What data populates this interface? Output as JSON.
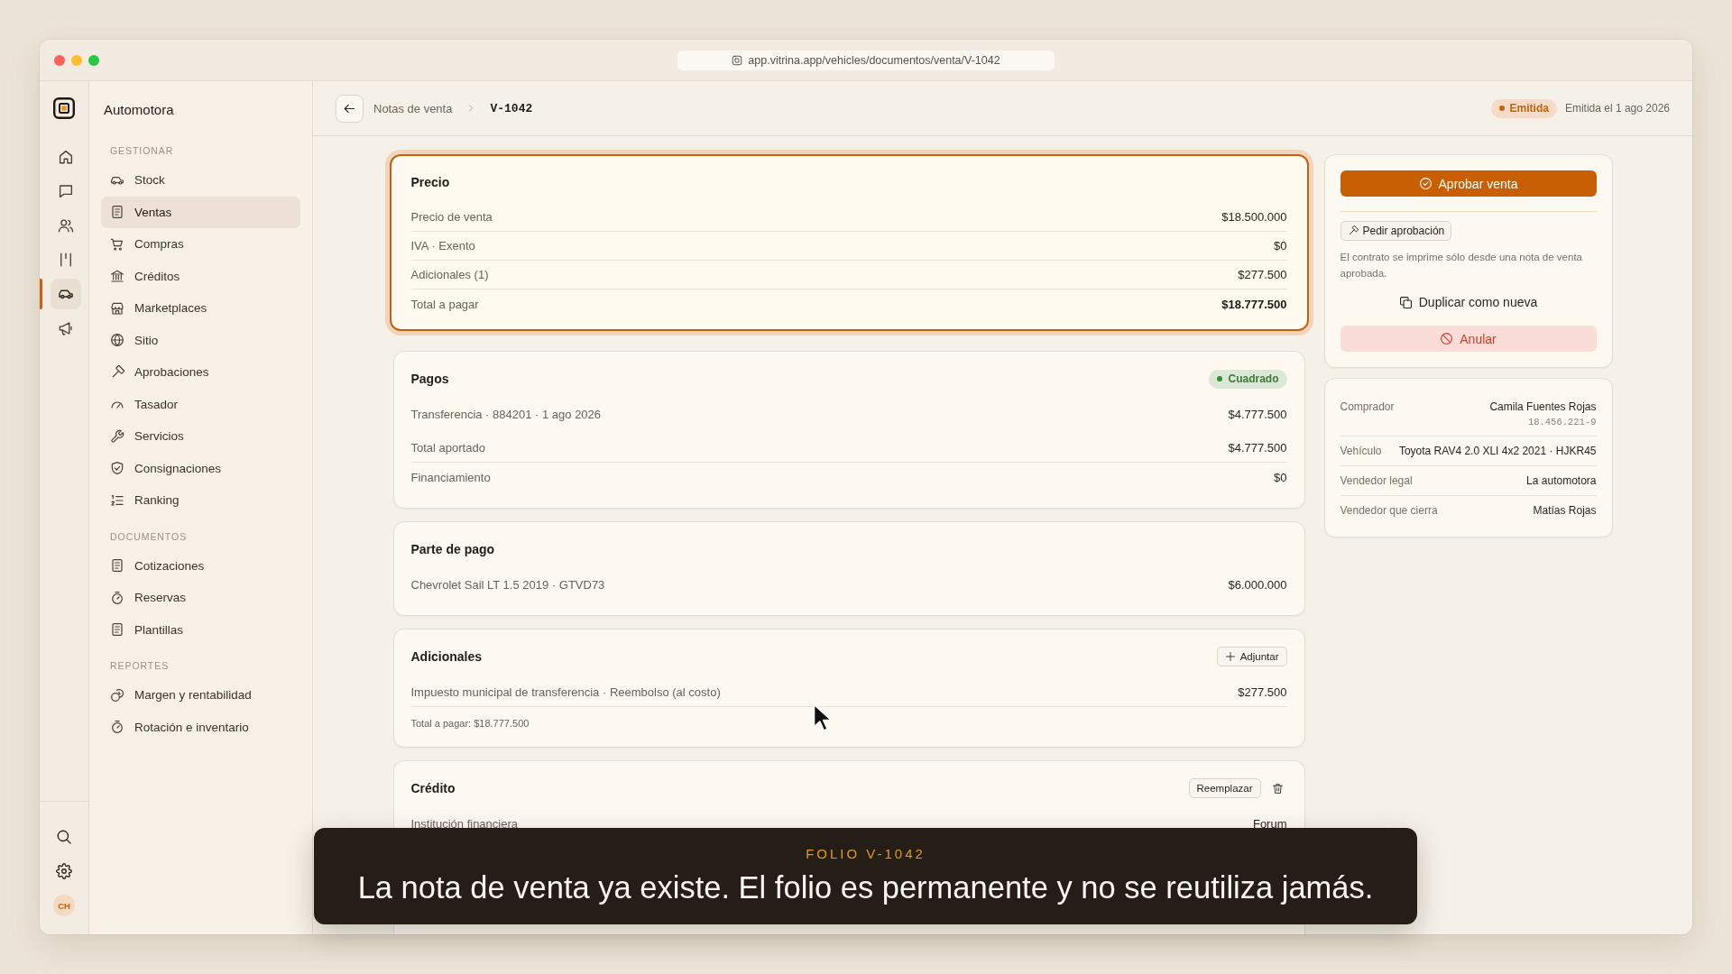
{
  "browser": {
    "url": "app.vitrina.app/vehicles/documentos/venta/V-1042"
  },
  "rail": {
    "items": [
      {
        "selected": false
      },
      {
        "selected": false
      },
      {
        "selected": false
      },
      {
        "selected": false
      },
      {
        "selected": true
      },
      {
        "selected": false
      }
    ],
    "avatar": "CH"
  },
  "sidebar": {
    "title": "Automotora",
    "sections": [
      {
        "heading": "GESTIONAR",
        "items": [
          {
            "label": "Stock",
            "selected": false
          },
          {
            "label": "Ventas",
            "selected": true
          },
          {
            "label": "Compras",
            "selected": false
          },
          {
            "label": "Créditos",
            "selected": false
          },
          {
            "label": "Marketplaces",
            "selected": false
          },
          {
            "label": "Sitio",
            "selected": false
          },
          {
            "label": "Aprobaciones",
            "selected": false
          },
          {
            "label": "Tasador",
            "selected": false
          },
          {
            "label": "Servicios",
            "selected": false
          },
          {
            "label": "Consignaciones",
            "selected": false
          },
          {
            "label": "Ranking",
            "selected": false
          }
        ]
      },
      {
        "heading": "DOCUMENTOS",
        "items": [
          {
            "label": "Cotizaciones",
            "selected": false
          },
          {
            "label": "Reservas",
            "selected": false
          },
          {
            "label": "Plantillas",
            "selected": false
          }
        ]
      },
      {
        "heading": "REPORTES",
        "items": [
          {
            "label": "Margen y rentabilidad",
            "selected": false
          },
          {
            "label": "Rotación e inventario",
            "selected": false
          }
        ]
      }
    ]
  },
  "header": {
    "parent": "Notas de venta",
    "current": "V-1042",
    "status": "Emitida",
    "issued": "Emitida el 1 ago 2026"
  },
  "cards": [
    {
      "title": "Precio",
      "highlighted": true,
      "sections": [
        {
          "rows": [
            {
              "label": "Precio de venta",
              "value": "$18.500.000",
              "total": false
            },
            {
              "label": "IVA · Exento",
              "value": "$0",
              "total": false
            },
            {
              "label": "Adicionales (1)",
              "value": "$277.500",
              "total": false
            },
            {
              "label": "Total a pagar",
              "value": "$18.777.500",
              "total": true
            }
          ]
        }
      ]
    },
    {
      "title": "Pagos",
      "highlighted": false,
      "badge": "Cuadrado",
      "sections": [
        {
          "rows": [
            {
              "label": "Transferencia · 884201 · 1 ago 2026",
              "value": "$4.777.500",
              "total": false
            }
          ]
        },
        {
          "rows": [
            {
              "label": "Total aportado",
              "value": "$4.777.500",
              "total": false
            },
            {
              "label": "Financiamiento",
              "value": "$0",
              "total": false
            }
          ]
        }
      ]
    },
    {
      "title": "Parte de pago",
      "highlighted": false,
      "sections": [
        {
          "rows": [
            {
              "label": "Chevrolet Sail LT 1.5 2019 · GTVD73",
              "value": "$6.000.000",
              "total": false
            }
          ]
        }
      ]
    },
    {
      "title": "Adicionales",
      "highlighted": false,
      "action": {
        "kind": "add",
        "label": "Adjuntar"
      },
      "sections": [
        {
          "rows": [
            {
              "label": "Impuesto municipal de transferencia · Reembolso (al costo)",
              "value": "$277.500",
              "total": false
            }
          ]
        }
      ],
      "footnote": "Total a pagar: $18.777.500"
    },
    {
      "title": "Crédito",
      "highlighted": false,
      "action": {
        "kind": "replace",
        "label": "Reemplazar"
      },
      "sections": [
        {
          "rows": [
            {
              "label": "Institución financiera",
              "value": "Forum",
              "total": false
            }
          ]
        }
      ]
    }
  ],
  "panel": {
    "approve": "Aprobar venta",
    "request": "Pedir aprobación",
    "note": "El contrato se imprime sólo desde una nota de venta aprobada.",
    "duplicate": "Duplicar como nueva",
    "void": "Anular"
  },
  "details": [
    {
      "label": "Comprador",
      "value": "Camila Fuentes Rojas",
      "sub": "18.456.221-9"
    },
    {
      "label": "Vehículo",
      "value": "Toyota RAV4 2.0 XLI 4x2 2021 · HJKR45"
    },
    {
      "label": "Vendedor legal",
      "value": "La automotora"
    },
    {
      "label": "Vendedor que cierra",
      "value": "Matías Rojas"
    }
  ],
  "caption": {
    "label": "FOLIO V-1042",
    "text": "La nota de venta ya existe. El folio es permanente y no se reutiliza jamás."
  }
}
